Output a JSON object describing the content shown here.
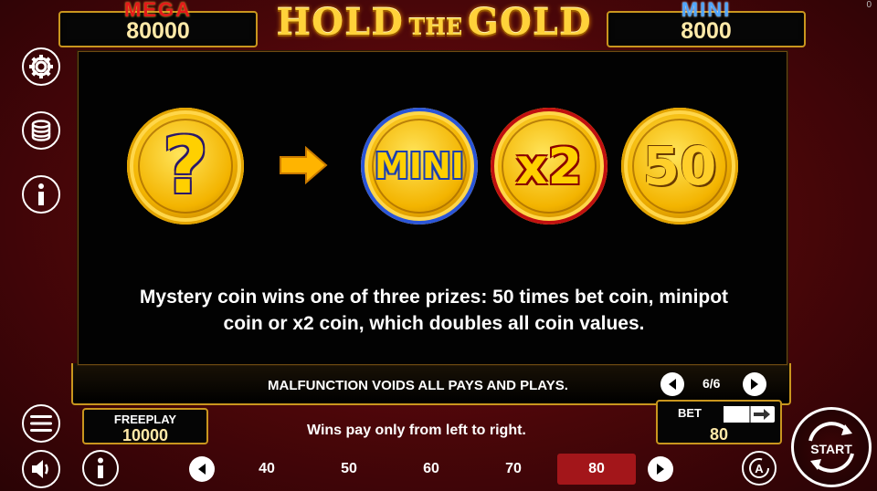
{
  "corner_value": "0",
  "jackpots": {
    "mega": {
      "name": "MEGA",
      "value": "80000"
    },
    "mini": {
      "name": "MINI",
      "value": "8000"
    }
  },
  "logo": {
    "part1": "HOLD",
    "part2": "THE",
    "part3": "GOLD"
  },
  "side_icons": [
    "gear-icon",
    "coin-stack-icon",
    "info-icon",
    "menu-icon",
    "sound-icon"
  ],
  "info_page": {
    "coins": {
      "mystery": "?",
      "mini": "MINI",
      "x2": "x2",
      "fifty": "50"
    },
    "description_line1": "Mystery coin wins one of three prizes: 50 times bet coin, minipot",
    "description_line2": "coin or x2 coin, which doubles all coin values.",
    "page_indicator": "6/6"
  },
  "malfunction_notice": "MALFUNCTION VOIDS ALL PAYS AND PLAYS.",
  "wins_notice": "Wins pay only from left to right.",
  "freeplay": {
    "label": "FREEPLAY",
    "value": "10000"
  },
  "bet": {
    "label": "BET",
    "value": "80"
  },
  "bet_options": [
    "40",
    "50",
    "60",
    "70",
    "80"
  ],
  "selected_bet": "80",
  "start_label": "START",
  "colors": {
    "accent_gold": "#c9961e",
    "selected_bet": "#a3161a",
    "background": "#4a0609"
  }
}
